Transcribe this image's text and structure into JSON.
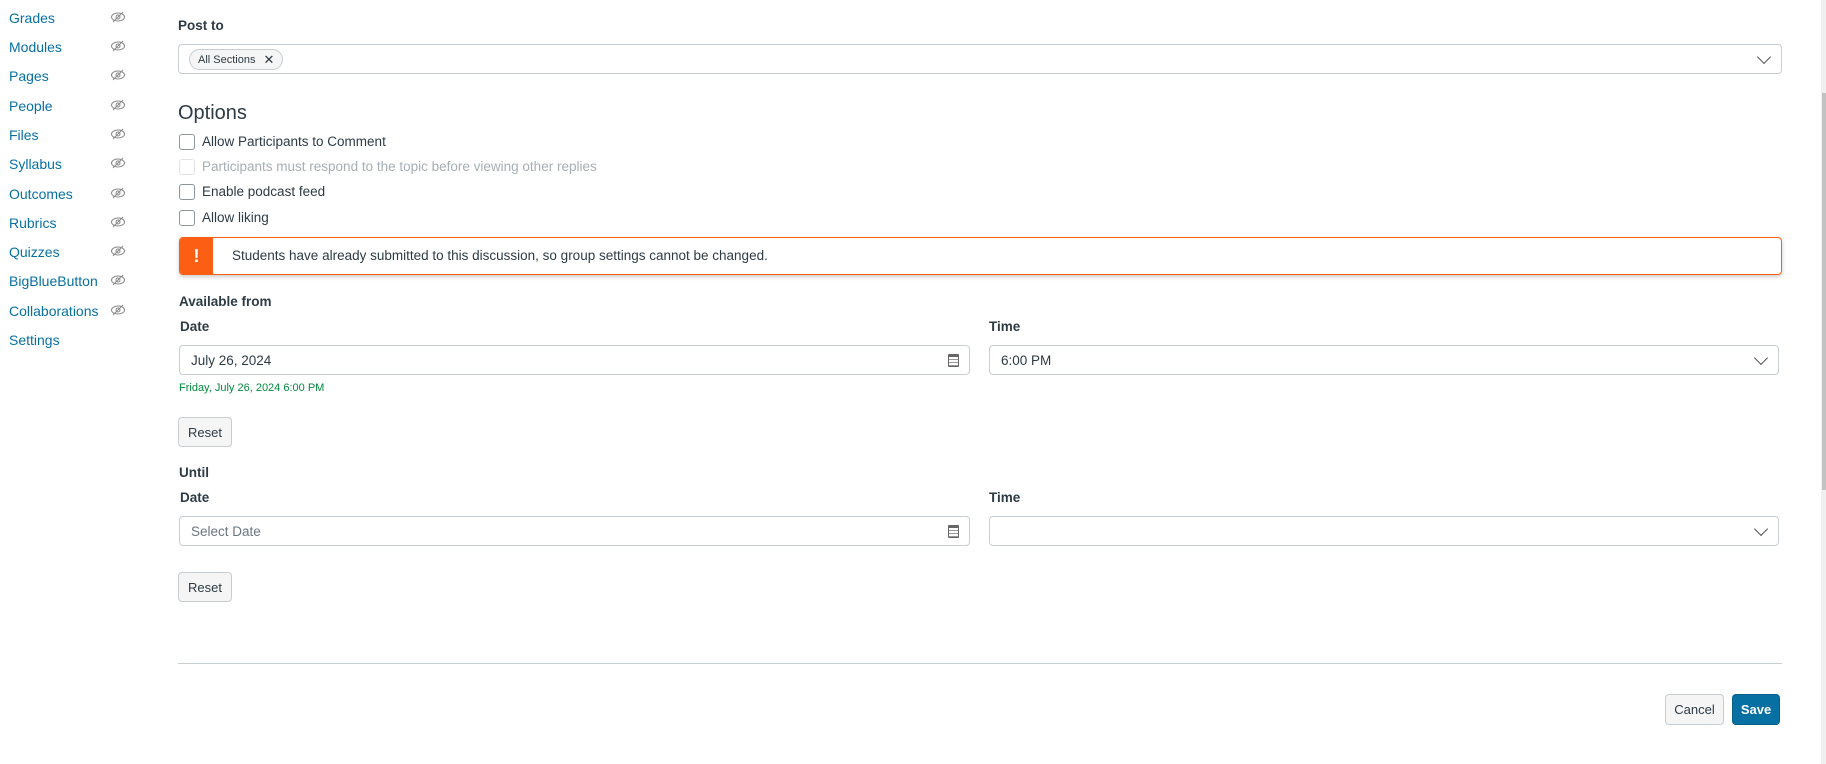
{
  "sidebar": {
    "items": [
      {
        "label": "Grades",
        "hidden": true
      },
      {
        "label": "Modules",
        "hidden": true
      },
      {
        "label": "Pages",
        "hidden": true
      },
      {
        "label": "People",
        "hidden": true
      },
      {
        "label": "Files",
        "hidden": true
      },
      {
        "label": "Syllabus",
        "hidden": true
      },
      {
        "label": "Outcomes",
        "hidden": true
      },
      {
        "label": "Rubrics",
        "hidden": true
      },
      {
        "label": "Quizzes",
        "hidden": true
      },
      {
        "label": "BigBlueButton",
        "hidden": true
      },
      {
        "label": "Collaborations",
        "hidden": true
      },
      {
        "label": "Settings",
        "hidden": false
      }
    ]
  },
  "post_to": {
    "label": "Post to",
    "tags": [
      "All Sections"
    ]
  },
  "options": {
    "title": "Options",
    "checkboxes": [
      {
        "label": "Allow Participants to Comment",
        "checked": false,
        "disabled": false
      },
      {
        "label": "Participants must respond to the topic before viewing other replies",
        "checked": false,
        "disabled": true
      },
      {
        "label": "Enable podcast feed",
        "checked": false,
        "disabled": false
      },
      {
        "label": "Allow liking",
        "checked": false,
        "disabled": false
      }
    ]
  },
  "warning": {
    "icon": "!",
    "text": "Students have already submitted to this discussion, so group settings cannot be changed.",
    "color": "#fc5e13"
  },
  "available_from": {
    "title": "Available from",
    "date_label": "Date",
    "time_label": "Time",
    "date_value": "July 26, 2024",
    "time_value": "6:00 PM",
    "summary": "Friday, July 26, 2024 6:00 PM",
    "reset": "Reset"
  },
  "until": {
    "title": "Until",
    "date_label": "Date",
    "time_label": "Time",
    "date_placeholder": "Select Date",
    "time_value": "",
    "reset": "Reset"
  },
  "footer": {
    "cancel": "Cancel",
    "save": "Save"
  },
  "colors": {
    "link": "#0770a3",
    "primary": "#0770a3",
    "success_text": "#03893d"
  }
}
